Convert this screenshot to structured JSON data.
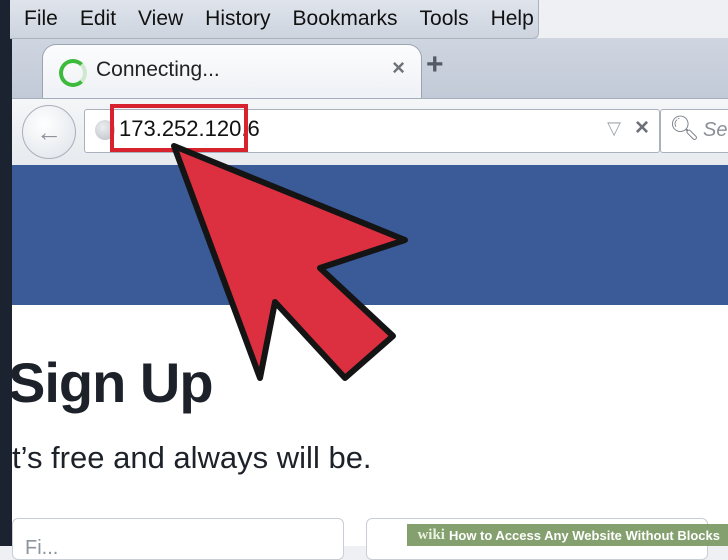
{
  "menu": {
    "items": [
      "File",
      "Edit",
      "View",
      "History",
      "Bookmarks",
      "Tools",
      "Help"
    ]
  },
  "tab": {
    "title": "Connecting...",
    "close_glyph": "×",
    "new_tab_glyph": "+"
  },
  "navbar": {
    "back_glyph": "←",
    "url": "173.252.120.6",
    "dropdown_glyph": "▽",
    "stop_glyph": "×",
    "search_placeholder": "Sec"
  },
  "page": {
    "heading": "Sign Up",
    "tagline": "t’s free and always will be.",
    "first_field_placeholder": "Fi..."
  },
  "watermark": {
    "brand": "wiki",
    "title": "How to Access Any Website Without Blocks"
  },
  "colors": {
    "facebook_blue": "#3b5a98",
    "highlight_red": "#d6232e",
    "arrow_red": "#dc3040"
  },
  "icons": [
    "loading-spinner-icon",
    "back-arrow-icon",
    "globe-icon",
    "search-icon",
    "red-pointer-arrow-icon"
  ]
}
